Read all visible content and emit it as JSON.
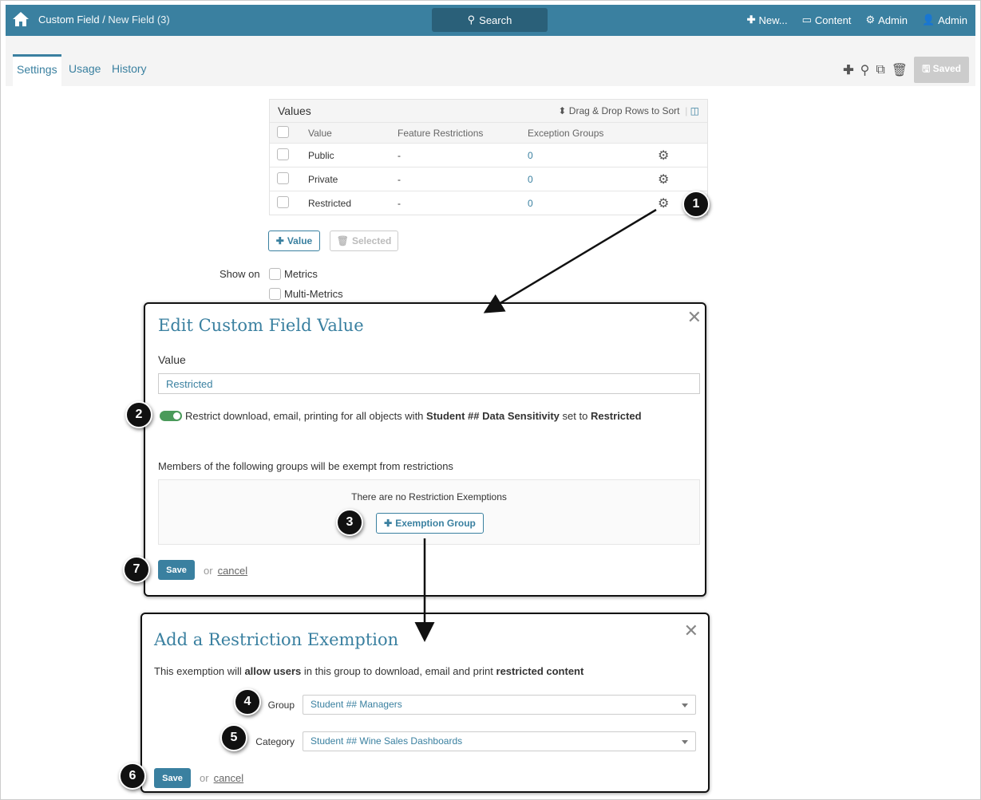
{
  "header": {
    "breadcrumb_root": "Custom Field",
    "breadcrumb_sep": " / ",
    "breadcrumb_current": "New Field (3)",
    "search": "Search",
    "new": "New...",
    "content": "Content",
    "admin_settings": "Admin",
    "user": "Admin"
  },
  "tabs": [
    "Settings",
    "Usage",
    "History"
  ],
  "toolbar": {
    "saved": "Saved"
  },
  "values_table": {
    "title": "Values",
    "sort_hint": "Drag & Drop Rows to Sort",
    "columns": [
      "Value",
      "Feature Restrictions",
      "Exception Groups"
    ],
    "rows": [
      {
        "value": "Public",
        "restrictions": "-",
        "groups": "0"
      },
      {
        "value": "Private",
        "restrictions": "-",
        "groups": "0"
      },
      {
        "value": "Restricted",
        "restrictions": "-",
        "groups": "0"
      }
    ]
  },
  "buttons": {
    "add_value": "Value",
    "delete_selected": "Selected"
  },
  "show_on": {
    "label": "Show on",
    "options": [
      "Metrics",
      "Multi-Metrics"
    ]
  },
  "edit_modal": {
    "title": "Edit Custom Field Value",
    "value_label": "Value",
    "value": "Restricted",
    "toggle_text_1": "Restrict download, email, printing for all objects with ",
    "toggle_bold_1": "Student ## Data Sensitivity",
    "toggle_text_2": " set to ",
    "toggle_bold_2": "Restricted",
    "exempt_label": "Members of the following groups will be exempt from restrictions",
    "no_exemptions": "There are no Restriction Exemptions",
    "add_exemption": "Exemption Group",
    "save": "Save",
    "or": "or",
    "cancel": "cancel"
  },
  "exemption_modal": {
    "title": "Add a Restriction Exemption",
    "desc_1": "This exemption will ",
    "desc_bold_1": "allow users",
    "desc_2": " in this group to download, email and print ",
    "desc_bold_2": "restricted content",
    "group_label": "Group",
    "group_value": "Student ## Managers",
    "category_label": "Category",
    "category_value": "Student ## Wine Sales Dashboards",
    "save": "Save",
    "or": "or",
    "cancel": "cancel"
  },
  "callouts": [
    "1",
    "2",
    "3",
    "4",
    "5",
    "6",
    "7"
  ],
  "colors": {
    "brand": "#3a80a0",
    "toggle": "#4a9a5a"
  }
}
